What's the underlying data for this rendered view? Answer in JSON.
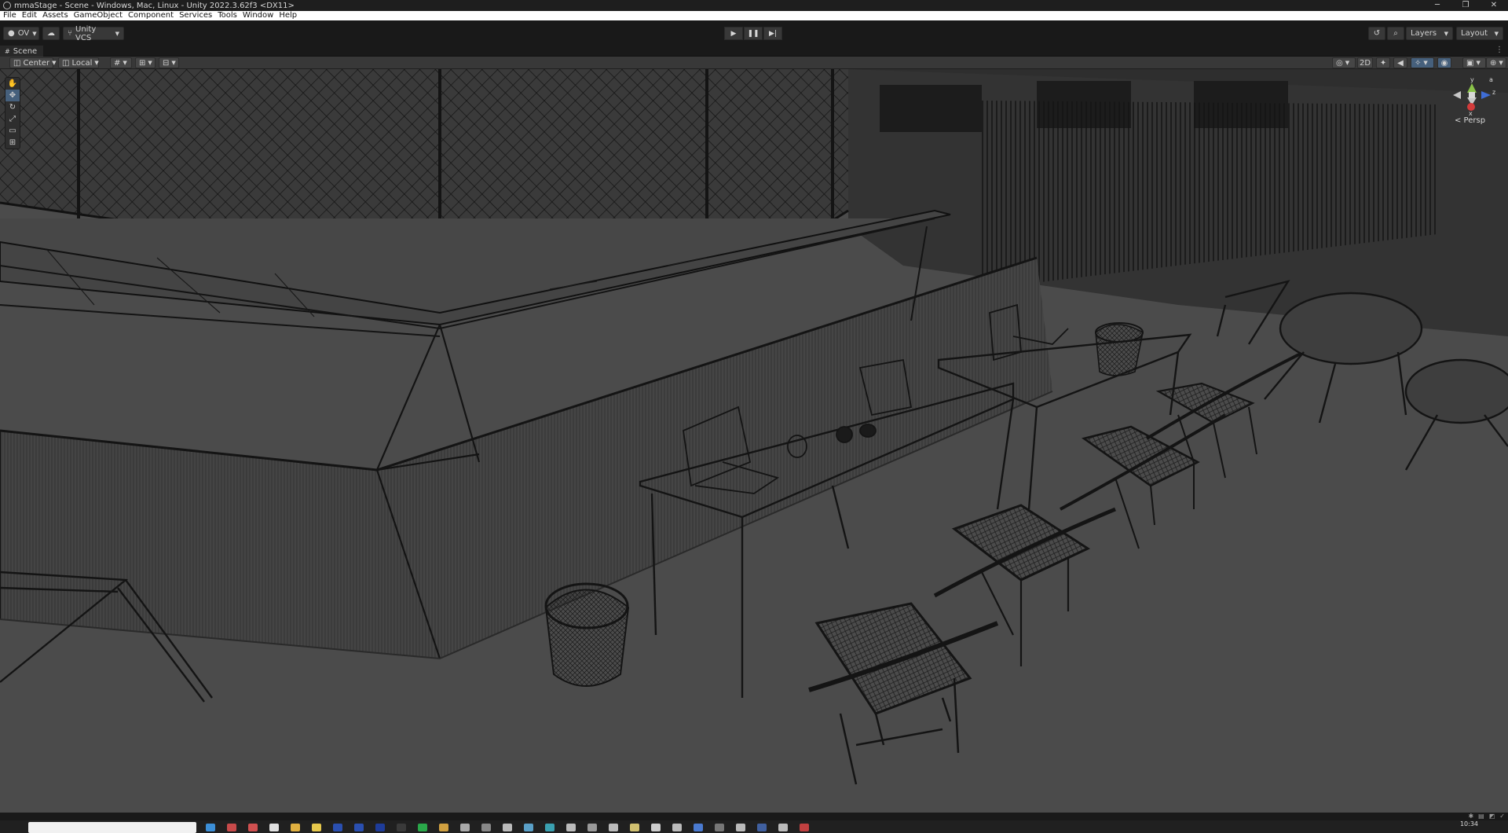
{
  "window": {
    "title": "mmaStage - Scene - Windows, Mac, Linux - Unity 2022.3.62f3 <DX11>",
    "controls": [
      "─",
      "❐",
      "✕"
    ]
  },
  "menu": [
    "File",
    "Edit",
    "Assets",
    "GameObject",
    "Component",
    "Services",
    "Tools",
    "Window",
    "Help"
  ],
  "toolbar": {
    "account": "OV",
    "vcs": "Unity VCS",
    "layers": "Layers",
    "layout": "Layout"
  },
  "scene_tab": {
    "label": "Scene"
  },
  "scene_toolbar": {
    "pivot": "Center",
    "space": "Local",
    "mode_2d": "2D"
  },
  "gizmo": {
    "y_label": "y",
    "z_label": "z",
    "x_label": "x",
    "view_label": "< Persp"
  },
  "taskbar": {
    "time": "10:34"
  },
  "colors": {
    "viewport_bg": "#4b4b4b",
    "wire": "#121212",
    "active_tool": "#46607c"
  }
}
